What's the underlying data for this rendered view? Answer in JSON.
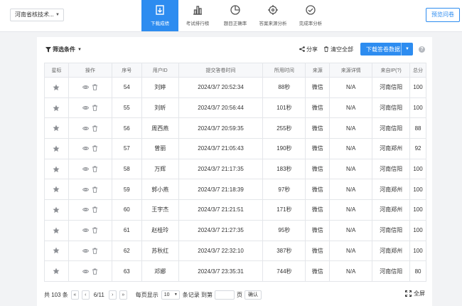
{
  "header": {
    "survey_select": "河南省核技术...",
    "tabs": [
      {
        "label": "下载成绩",
        "icon": "download-icon",
        "active": true
      },
      {
        "label": "考试排行榜",
        "icon": "bar-chart-icon"
      },
      {
        "label": "题目正确率",
        "icon": "pie-chart-icon"
      },
      {
        "label": "答案来源分析",
        "icon": "target-icon"
      },
      {
        "label": "完成率分析",
        "icon": "check-circle-icon"
      }
    ],
    "preview_button": "预览问卷",
    "accent_color": "#2d8cf0"
  },
  "toolbar": {
    "filter_label": "筛选条件",
    "share_label": "分享",
    "clear_label": "清空全部",
    "download_label": "下载答卷数据",
    "help_icon": "?"
  },
  "table": {
    "columns": [
      "星标",
      "操作",
      "序号",
      "用户ID",
      "提交答卷时间",
      "所用时间",
      "来源",
      "来源详情",
      "来自IP(?)",
      "总分"
    ],
    "rows": [
      {
        "seq": "54",
        "user": "刘婷",
        "time": "2024/3/7 20:52:34",
        "duration": "88秒",
        "source": "微信",
        "detail": "N/A",
        "ip": "河南信阳",
        "score": "100"
      },
      {
        "seq": "55",
        "user": "刘昕",
        "time": "2024/3/7 20:56:44",
        "duration": "101秒",
        "source": "微信",
        "detail": "N/A",
        "ip": "河南信阳",
        "score": "100"
      },
      {
        "seq": "56",
        "user": "周西燕",
        "time": "2024/3/7 20:59:35",
        "duration": "255秒",
        "source": "微信",
        "detail": "N/A",
        "ip": "河南信阳",
        "score": "88"
      },
      {
        "seq": "57",
        "user": "曾丽",
        "time": "2024/3/7 21:05:43",
        "duration": "190秒",
        "source": "微信",
        "detail": "N/A",
        "ip": "河南郑州",
        "score": "92"
      },
      {
        "seq": "58",
        "user": "万辉",
        "time": "2024/3/7 21:17:35",
        "duration": "183秒",
        "source": "微信",
        "detail": "N/A",
        "ip": "河南信阳",
        "score": "100"
      },
      {
        "seq": "59",
        "user": "郭小燕",
        "time": "2024/3/7 21:18:39",
        "duration": "97秒",
        "source": "微信",
        "detail": "N/A",
        "ip": "河南郑州",
        "score": "100"
      },
      {
        "seq": "60",
        "user": "王宇杰",
        "time": "2024/3/7 21:21:51",
        "duration": "171秒",
        "source": "微信",
        "detail": "N/A",
        "ip": "河南郑州",
        "score": "100"
      },
      {
        "seq": "61",
        "user": "赵桂玲",
        "time": "2024/3/7 21:27:35",
        "duration": "95秒",
        "source": "微信",
        "detail": "N/A",
        "ip": "河南信阳",
        "score": "100"
      },
      {
        "seq": "62",
        "user": "苏秋红",
        "time": "2024/3/7 22:32:10",
        "duration": "387秒",
        "source": "微信",
        "detail": "N/A",
        "ip": "河南郑州",
        "score": "100"
      },
      {
        "seq": "63",
        "user": "邓娜",
        "time": "2024/3/7 23:35:31",
        "duration": "744秒",
        "source": "微信",
        "detail": "N/A",
        "ip": "河南信阳",
        "score": "80"
      }
    ]
  },
  "pagination": {
    "total": "共 103 条",
    "page_info": "6/11",
    "per_page_label": "每页显示",
    "per_page_value": "10",
    "records_label": "条记录 到第",
    "page_suffix": "页",
    "confirm": "确认",
    "fullscreen": "全屏"
  }
}
